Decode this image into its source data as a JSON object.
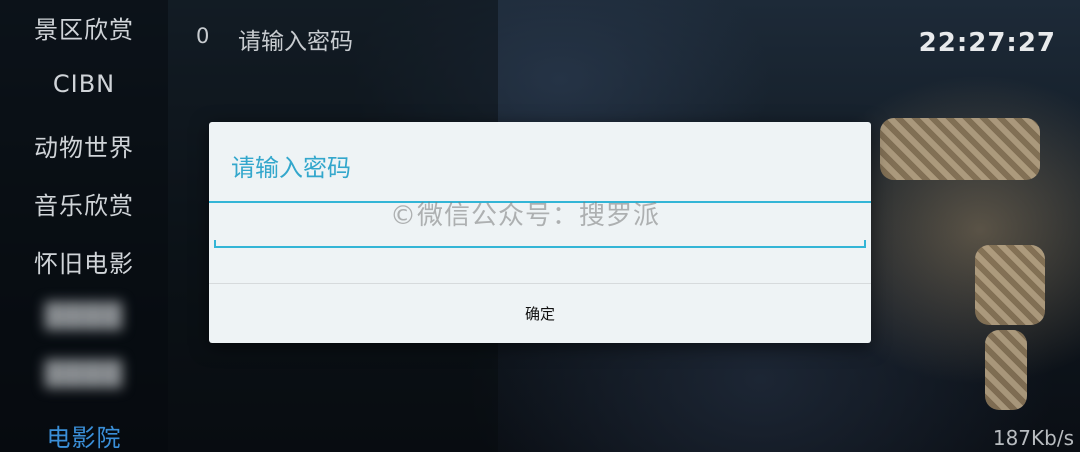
{
  "sidebar": {
    "items": [
      {
        "label": "景区欣赏",
        "state": "normal"
      },
      {
        "label": "CIBN",
        "state": "normal"
      },
      {
        "label": "动物世界",
        "state": "normal"
      },
      {
        "label": "音乐欣赏",
        "state": "normal"
      },
      {
        "label": "怀旧电影",
        "state": "normal"
      },
      {
        "label": "████",
        "state": "blurred"
      },
      {
        "label": "████",
        "state": "blurred"
      },
      {
        "label": "电影院",
        "state": "active"
      }
    ]
  },
  "channel_list": {
    "number": "0",
    "text": "请输入密码"
  },
  "status": {
    "clock": "22:27:27",
    "speed": "187Kb/s"
  },
  "dialog": {
    "title": "请输入密码",
    "input_value": "",
    "input_placeholder": "",
    "ok_label": "确定"
  },
  "watermark": "©微信公众号：搜罗派",
  "colors": {
    "accent": "#33b5d6",
    "title": "#33a7cc",
    "active_channel": "#3a8fd8",
    "dialog_bg": "#eef3f5"
  }
}
